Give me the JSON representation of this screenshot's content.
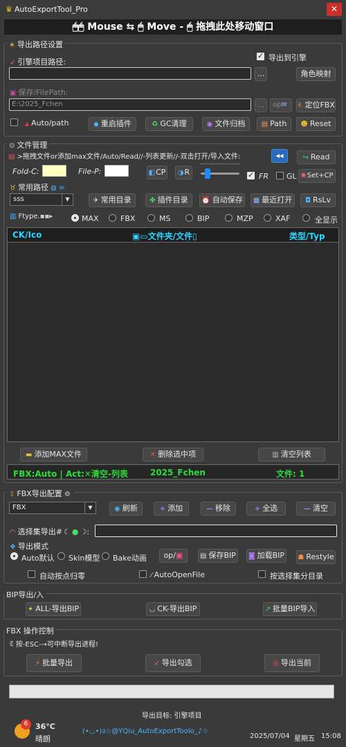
{
  "titlebar": {
    "title": "AutoExportTool_Pro",
    "close": "✕"
  },
  "dragbar": {
    "text": "🖱🖱 Mouse ⇆ 🖱 Move - 🖱 拖拽此处移动窗口"
  },
  "export_path": {
    "group_title": "导出路径设置",
    "engine_label": "引擎项目路径:",
    "engine_value": "",
    "export_to_engine": "导出到引擎",
    "export_to_engine_checked": true,
    "browse": "...",
    "role_map": "角色映射",
    "save_label": "保存/FilePath:",
    "save_value": "E:\\2025_Fchen",
    "op": "op",
    "locate_fbx": "定位FBX",
    "auto_path": "Auto/path",
    "restart_plugin": "重启插件",
    "gc_clean": "GC清理",
    "file_archive": "文件归档",
    "path": "Path",
    "reset": "Reset"
  },
  "file_manager": {
    "group_title": "文件管理",
    "hint": ">拖拽文件or添加max文件/Auto/Read//-列表更新//-双击打开/导入文件:",
    "read_btn": "Read",
    "fold_c": "Fold-C:",
    "fold_color": "#ffffc0",
    "file_p": "File-P:",
    "file_color": "#ffffff",
    "cp": "CP",
    "r": "R",
    "fr": "FR",
    "fr_checked": true,
    "gl": "GL",
    "gl_checked": false,
    "set_cp": "Set+CP",
    "common_path_label": "常用路径",
    "path_select": "sss",
    "common_dir": "常用目录",
    "plugin_dir": "插件目录",
    "auto_save": "自动保存",
    "recent_open": "最近打开",
    "rslv": "RsLv",
    "ftype_label": "Ftype.",
    "ftypes": [
      "MAX",
      "FBX",
      "MS",
      "BIP",
      "MZP",
      "XAF",
      "全显示"
    ],
    "ftype_selected": "MAX",
    "col_ck": "CK/Ico",
    "col_folder": "文件夹/文件",
    "col_type": "类型/Typ",
    "add_max": "添加MAX文件",
    "delete_sel": "删除选中项",
    "clear_list": "清空列表",
    "status_left": "FBX:Auto | Act:✕清空-列表",
    "status_mid": "2025_Fchen",
    "status_right": "文件: 1"
  },
  "fbx_config": {
    "group_title": "FBX导出配置",
    "format": "FBX",
    "refresh": "刷新",
    "add": "添加",
    "remove": "移除",
    "select_all": "全选",
    "clear": "清空",
    "selset_label": "选择集导出#",
    "mode_label": "导出模式",
    "modes": [
      "Auto默认",
      "Skin模型",
      "Bake动画"
    ],
    "mode_selected": "Auto默认",
    "op": "op/",
    "save_bip": "保存BIP",
    "load_bip": "加载BIP",
    "restyle": "Restyle",
    "auto_bone_reset": "自动按点归零",
    "auto_open_file": "AutoOpenFile",
    "by_selset_dir": "按选择集分目录"
  },
  "bip_io": {
    "group_title": "BIP导出/入",
    "all_export": "ALL-导出BIP",
    "ck_export": "CK-导出BIP",
    "batch_import": "批量BIP导入"
  },
  "fbx_control": {
    "group_title": "FBX 操作控制",
    "hint": "按-ESC-→可中断导出进程!",
    "batch_export": "批量导出",
    "export_checked": "导出勾选",
    "export_current": "导出当前"
  },
  "progress": {
    "value": 0
  },
  "footer": {
    "target": "导出目标: 引擎项目",
    "temp": "36°C",
    "weather": "晴朗",
    "badge": "6",
    "marquee": "(•◡•)ง☆@YQiu_AutoExportToolo_♪☆",
    "date": "2025/07/04",
    "weekday": "星期五",
    "time": "15:08"
  }
}
